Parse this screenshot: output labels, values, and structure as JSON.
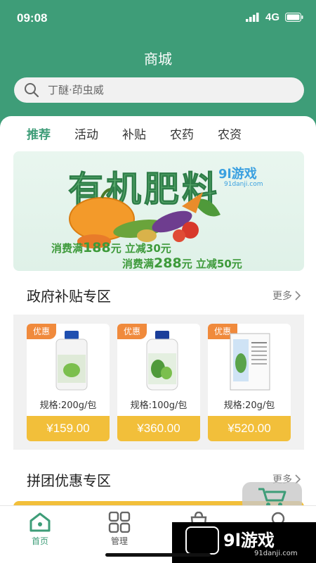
{
  "status": {
    "time": "09:08",
    "network": "4G"
  },
  "header": {
    "title": "商城"
  },
  "search": {
    "placeholder": "丁醚·茚虫威"
  },
  "tabs": [
    "推荐",
    "活动",
    "补贴",
    "农药",
    "农资"
  ],
  "banner": {
    "title": "有机肥料",
    "watermark": "9l游戏",
    "watermark_url": "91danji.com",
    "promo1_prefix": "消费满",
    "promo1_amount": "188",
    "promo1_suffix": "元 立减30元",
    "promo2_prefix": "消费满",
    "promo2_amount": "288",
    "promo2_suffix": "元 立减50元"
  },
  "subsidy": {
    "title": "政府补贴专区",
    "more": "更多",
    "products": [
      {
        "tag": "优惠",
        "spec": "规格:200g/包",
        "price": "¥159.00"
      },
      {
        "tag": "优惠",
        "spec": "规格:100g/包",
        "price": "¥360.00"
      },
      {
        "tag": "优惠",
        "spec": "规格:20g/包",
        "price": "¥520.00"
      }
    ]
  },
  "group": {
    "title": "拼团优惠专区",
    "more": "更多"
  },
  "tabbar": [
    {
      "label": "首页",
      "icon": "home-icon"
    },
    {
      "label": "管理",
      "icon": "grid-icon"
    },
    {
      "label": "",
      "icon": "cart-icon"
    },
    {
      "label": "",
      "icon": "user-icon"
    }
  ],
  "watermark": {
    "text": "9l游戏",
    "url": "91danji.com"
  },
  "colors": {
    "brand": "#3e9d78",
    "price_bg": "#f2bf3a",
    "tag_bg": "#f08a3c"
  }
}
